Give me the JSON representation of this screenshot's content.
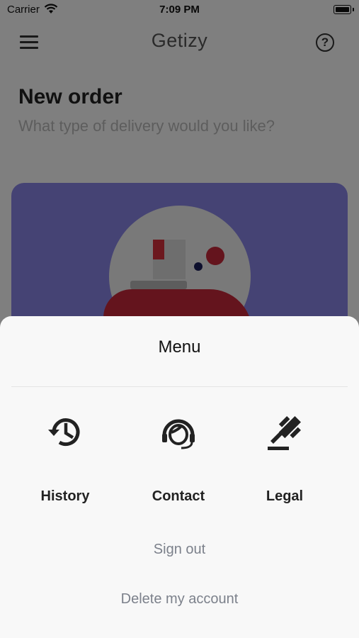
{
  "status_bar": {
    "carrier": "Carrier",
    "time": "7:09 PM",
    "wifi_icon": "wifi-icon",
    "battery_icon": "battery-icon"
  },
  "header": {
    "title": "Getizy",
    "menu_icon": "hamburger-icon",
    "help_icon": "help-circle-icon",
    "help_glyph": "?"
  },
  "page": {
    "title": "New order",
    "subtitle": "What type of delivery would you like?"
  },
  "card": {
    "background_color": "#8a86e8"
  },
  "menu_sheet": {
    "title": "Menu",
    "items": [
      {
        "label": "History",
        "icon": "history-icon"
      },
      {
        "label": "Contact",
        "icon": "headset-icon"
      },
      {
        "label": "Legal",
        "icon": "gavel-icon"
      }
    ],
    "sign_out": "Sign out",
    "delete_account": "Delete my account"
  },
  "colors": {
    "overlay": "rgba(0,0,0,0.5)",
    "sheet_background": "#f8f8f8",
    "link_text": "#7c818b",
    "label_text": "#222222"
  }
}
